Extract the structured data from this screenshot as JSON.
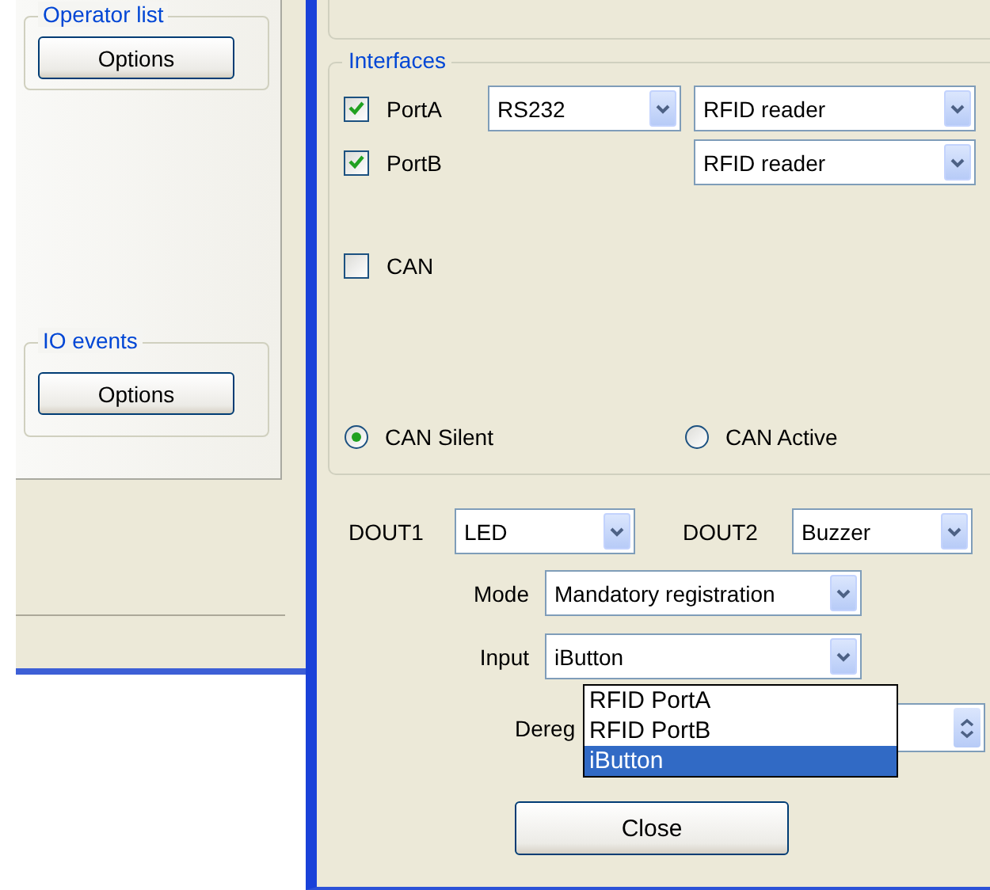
{
  "background_window": {
    "groups": [
      {
        "title": "Operator list",
        "button": "Options"
      },
      {
        "title": "IO events",
        "button": "Options"
      }
    ]
  },
  "dialog": {
    "interfaces": {
      "title": "Interfaces",
      "ports": [
        {
          "label": "PortA",
          "checked": true,
          "type": "RS232",
          "device": "RFID reader"
        },
        {
          "label": "PortB",
          "checked": true,
          "device": "RFID reader"
        }
      ],
      "can": {
        "label": "CAN",
        "checked": false
      },
      "can_modes": [
        {
          "label": "CAN Silent",
          "selected": true
        },
        {
          "label": "CAN Active",
          "selected": false
        }
      ]
    },
    "outputs": [
      {
        "label": "DOUT1",
        "value": "LED"
      },
      {
        "label": "DOUT2",
        "value": "Buzzer"
      }
    ],
    "mode": {
      "label": "Mode",
      "value": "Mandatory registration"
    },
    "input": {
      "label": "Input",
      "value": "iButton",
      "expanded": true,
      "options": [
        {
          "label": "RFID PortA",
          "selected": false
        },
        {
          "label": "RFID PortB",
          "selected": false
        },
        {
          "label": "iButton",
          "selected": true
        }
      ]
    },
    "deregistration": {
      "label": "Dereg"
    },
    "close_button": "Close"
  }
}
